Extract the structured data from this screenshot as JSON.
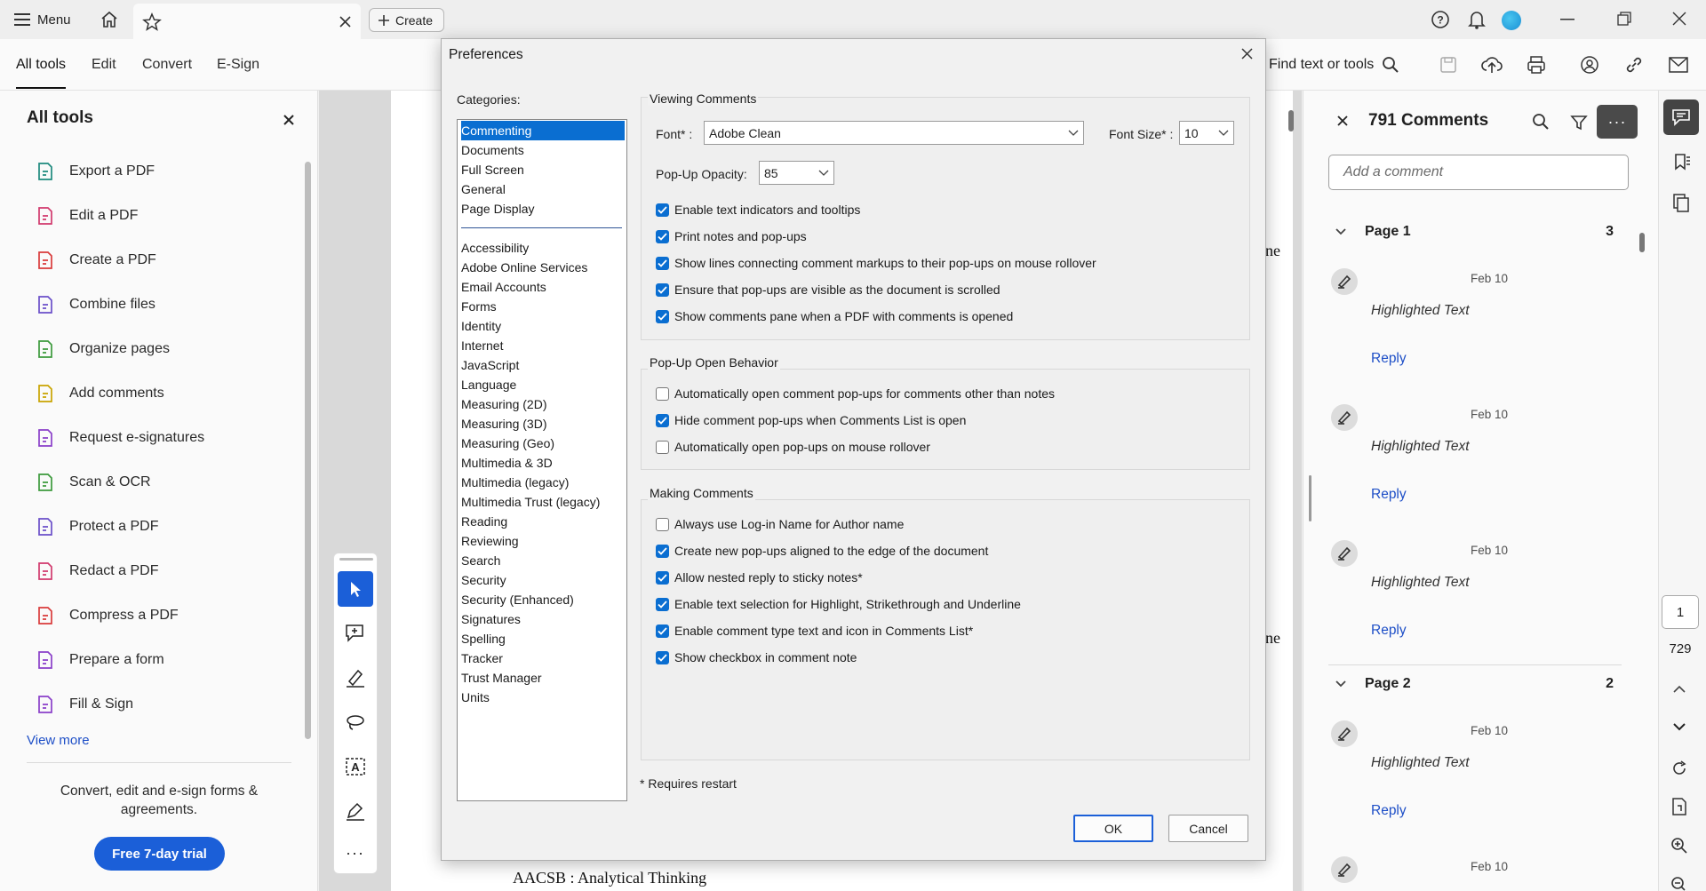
{
  "titlebar": {
    "menu_label": "Menu",
    "create_label": "Create"
  },
  "toolbar": {
    "tabs": [
      "All tools",
      "Edit",
      "Convert",
      "E-Sign"
    ],
    "find_label": "Find text or tools"
  },
  "left_panel": {
    "title": "All tools",
    "tools": [
      {
        "label": "Export a PDF",
        "icon": "export-pdf-icon",
        "color": "#1e8a7e"
      },
      {
        "label": "Edit a PDF",
        "icon": "edit-pdf-icon",
        "color": "#d1396d"
      },
      {
        "label": "Create a PDF",
        "icon": "create-pdf-icon",
        "color": "#d93b3b"
      },
      {
        "label": "Combine files",
        "icon": "combine-files-icon",
        "color": "#6a4fc9"
      },
      {
        "label": "Organize pages",
        "icon": "organize-pages-icon",
        "color": "#3c9a3c"
      },
      {
        "label": "Add comments",
        "icon": "add-comments-icon",
        "color": "#c9a400"
      },
      {
        "label": "Request e-signatures",
        "icon": "request-esignatures-icon",
        "color": "#8a3fc9"
      },
      {
        "label": "Scan & OCR",
        "icon": "scan-ocr-icon",
        "color": "#3c9a3c"
      },
      {
        "label": "Protect a PDF",
        "icon": "protect-pdf-icon",
        "color": "#6a4fc9"
      },
      {
        "label": "Redact a PDF",
        "icon": "redact-pdf-icon",
        "color": "#d1396d"
      },
      {
        "label": "Compress a PDF",
        "icon": "compress-pdf-icon",
        "color": "#d93b3b"
      },
      {
        "label": "Prepare a form",
        "icon": "prepare-form-icon",
        "color": "#8a3fc9"
      },
      {
        "label": "Fill & Sign",
        "icon": "fill-sign-icon",
        "color": "#8a3fc9"
      }
    ],
    "view_more": "View more",
    "promo": "Convert, edit and e-sign forms & agreements.",
    "trial_button": "Free 7-day trial"
  },
  "document": {
    "bottom_text": "AACSB : Analytical Thinking",
    "fragment_1": "ne",
    "fragment_2": "ne"
  },
  "comments_pane": {
    "title": "791 Comments",
    "add_placeholder": "Add a comment",
    "pages": [
      {
        "label": "Page 1",
        "count": "3"
      },
      {
        "label": "Page 2",
        "count": "2"
      }
    ],
    "comments": [
      {
        "date": "Feb 10",
        "text": "Highlighted Text",
        "reply": "Reply"
      },
      {
        "date": "Feb 10",
        "text": "Highlighted Text",
        "reply": "Reply"
      },
      {
        "date": "Feb 10",
        "text": "Highlighted Text",
        "reply": "Reply"
      },
      {
        "date": "Feb 10",
        "text": "Highlighted Text",
        "reply": "Reply"
      },
      {
        "date": "Feb 10"
      }
    ]
  },
  "rail": {
    "current_page": "1",
    "total_pages": "729"
  },
  "dialog": {
    "title": "Preferences",
    "categories_label": "Categories:",
    "categories_top": [
      "Commenting",
      "Documents",
      "Full Screen",
      "General",
      "Page Display"
    ],
    "categories_rest": [
      "Accessibility",
      "Adobe Online Services",
      "Email Accounts",
      "Forms",
      "Identity",
      "Internet",
      "JavaScript",
      "Language",
      "Measuring (2D)",
      "Measuring (3D)",
      "Measuring (Geo)",
      "Multimedia & 3D",
      "Multimedia (legacy)",
      "Multimedia Trust (legacy)",
      "Reading",
      "Reviewing",
      "Search",
      "Security",
      "Security (Enhanced)",
      "Signatures",
      "Spelling",
      "Tracker",
      "Trust Manager",
      "Units"
    ],
    "selected_category": "Commenting",
    "viewing": {
      "title": "Viewing Comments",
      "font_label": "Font* :",
      "font_value": "Adobe Clean",
      "font_size_label": "Font Size* :",
      "font_size_value": "10",
      "opacity_label": "Pop-Up Opacity:",
      "opacity_value": "85",
      "options": [
        {
          "label": "Enable text indicators and tooltips",
          "checked": true
        },
        {
          "label": "Print notes and pop-ups",
          "checked": true
        },
        {
          "label": "Show lines connecting comment markups to their pop-ups on mouse rollover",
          "checked": true
        },
        {
          "label": "Ensure that pop-ups are visible as the document is scrolled",
          "checked": true
        },
        {
          "label": "Show comments pane when a PDF with comments is opened",
          "checked": true
        }
      ]
    },
    "popup": {
      "title": "Pop-Up Open Behavior",
      "options": [
        {
          "label": "Automatically open comment pop-ups for comments other than notes",
          "checked": false
        },
        {
          "label": "Hide comment pop-ups when Comments List is open",
          "checked": true
        },
        {
          "label": "Automatically open pop-ups on mouse rollover",
          "checked": false
        }
      ]
    },
    "making": {
      "title": "Making Comments",
      "options": [
        {
          "label": "Always use Log-in Name for Author name",
          "checked": false
        },
        {
          "label": "Create new pop-ups aligned to the edge of the document",
          "checked": true
        },
        {
          "label": "Allow nested reply to sticky notes*",
          "checked": true
        },
        {
          "label": "Enable text selection for Highlight, Strikethrough and Underline",
          "checked": true
        },
        {
          "label": "Enable comment type text and icon in Comments List*",
          "checked": true
        },
        {
          "label": "Show checkbox in comment note",
          "checked": true
        }
      ]
    },
    "requires_restart": "* Requires restart",
    "ok": "OK",
    "cancel": "Cancel"
  }
}
